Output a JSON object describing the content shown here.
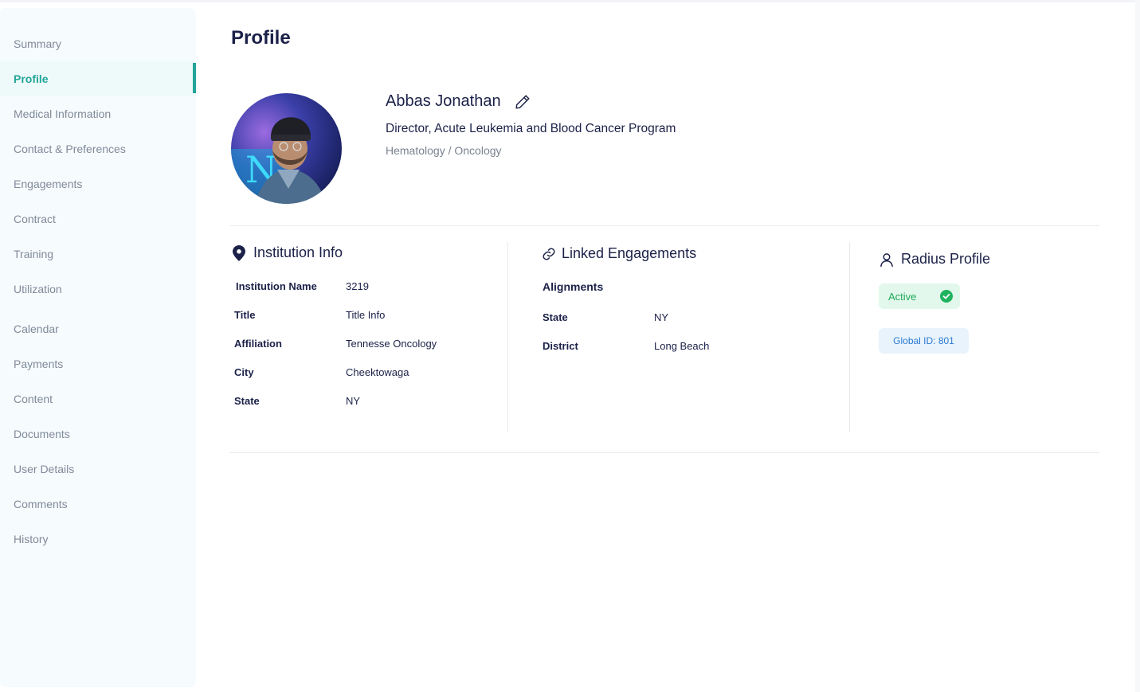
{
  "sidebar": {
    "items": [
      {
        "label": "Summary"
      },
      {
        "label": "Profile"
      },
      {
        "label": "Medical Information"
      },
      {
        "label": "Contact & Preferences"
      },
      {
        "label": "Engagements"
      },
      {
        "label": "Contract"
      },
      {
        "label": "Training"
      },
      {
        "label": "Utilization"
      },
      {
        "label": "Calendar"
      },
      {
        "label": "Payments"
      },
      {
        "label": "Content"
      },
      {
        "label": "Documents"
      },
      {
        "label": "User Details"
      },
      {
        "label": "Comments"
      },
      {
        "label": "History"
      }
    ],
    "active": "Profile"
  },
  "page": {
    "title": "Profile"
  },
  "profile": {
    "name": "Abbas Jonathan",
    "job_title": "Director, Acute Leukemia and Blood Cancer Program",
    "specialty": "Hematology / Oncology",
    "avatar_icon": "profile-photo",
    "edit_icon": "pencil-icon"
  },
  "institution": {
    "title": "Institution Info",
    "icon": "location-pin-icon",
    "rows": [
      {
        "label": "Institution Name",
        "value": "3219"
      },
      {
        "label": "Title",
        "value": "Title Info"
      },
      {
        "label": "Affiliation",
        "value": "Tennesse Oncology"
      },
      {
        "label": "City",
        "value": "Cheektowaga"
      },
      {
        "label": "State",
        "value": "NY"
      }
    ]
  },
  "linked": {
    "title": "Linked Engagements",
    "icon": "link-icon",
    "subheading": "Alignments",
    "rows": [
      {
        "label": "State",
        "value": "NY"
      },
      {
        "label": "District",
        "value": "Long Beach"
      }
    ]
  },
  "radius": {
    "title": "Radius Profile",
    "icon": "user-icon",
    "status": "Active",
    "global_id": "Global ID: 801"
  },
  "colors": {
    "accent": "#23a59a",
    "text": "#1b2148",
    "muted": "#7f8a9a",
    "status_green": "#1fa85a",
    "id_blue": "#2b7bd0"
  }
}
